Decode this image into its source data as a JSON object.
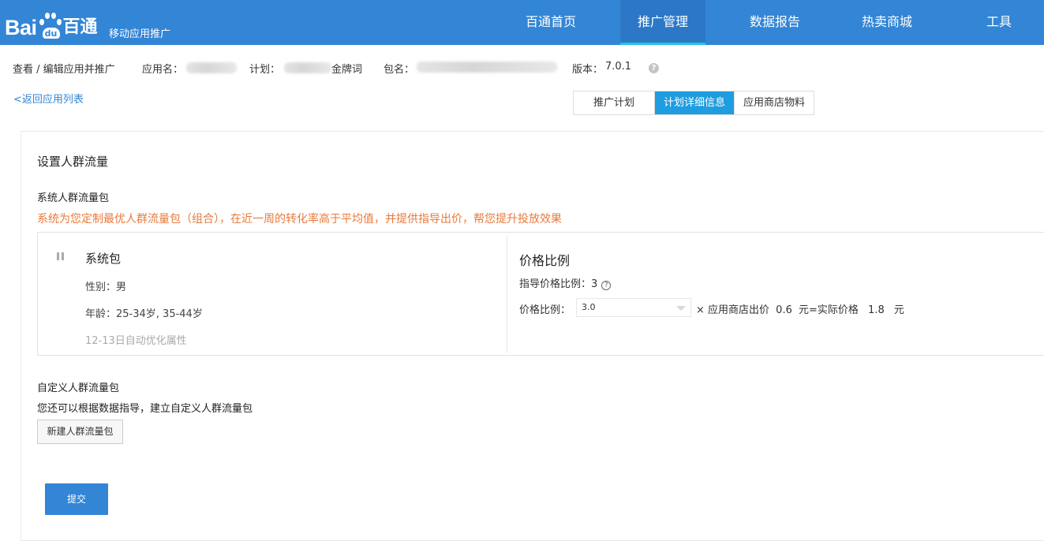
{
  "header": {
    "logo_text_left": "Bai",
    "logo_paw_text": "du",
    "logo_text_cn": "百通",
    "subtitle": "移动应用推广",
    "nav": [
      {
        "label": "百通首页",
        "active": false
      },
      {
        "label": "推广管理",
        "active": true
      },
      {
        "label": "数据报告",
        "active": false
      },
      {
        "label": "热卖商城",
        "active": false
      },
      {
        "label": "工具",
        "active": false
      }
    ],
    "brand_color": "#3385d6",
    "active_indicator_color": "#1fc4e8"
  },
  "info": {
    "breadcrumb": "查看 / 编辑应用并推广",
    "app_name_label": "应用名：",
    "plan_label": "计划：",
    "plan_suffix": "金牌词",
    "package_label": "包名：",
    "version_label": "版本：",
    "version_value": "7.0.1",
    "help_icon": "question-circle-icon"
  },
  "back_link": "<返回应用列表",
  "tabs": [
    {
      "label": "推广计划",
      "active": false
    },
    {
      "label": "计划详细信息",
      "active": true
    },
    {
      "label": "应用商店物料",
      "active": false
    }
  ],
  "section": {
    "title": "设置人群流量",
    "system_label": "系统人群流量包",
    "system_notice": "系统为您定制最优人群流量包（组合），在近一周的转化率高于平均值，并提供指导出价，帮您提升投放效果",
    "notice_color": "#e87a3c"
  },
  "system_package": {
    "name": "系统包",
    "gender_label": "性别：",
    "gender_value": "男",
    "age_label": "年龄：",
    "age_value": "25-34岁, 35-44岁",
    "auto_note": "12-13日自动优化属性"
  },
  "price": {
    "title": "价格比例",
    "guide_label": "指导价格比例：",
    "guide_value": "3",
    "ratio_label": "价格比例：",
    "ratio_value": "3.0",
    "multiply_text": "× 应用商店出价",
    "store_bid": "0.6",
    "unit_eq_text": "元=实际价格",
    "actual_price": "1.8",
    "unit": "元"
  },
  "custom": {
    "label": "自定义人群流量包",
    "description": "您还可以根据数据指导，建立自定义人群流量包",
    "new_button": "新建人群流量包"
  },
  "submit_button": "提交"
}
